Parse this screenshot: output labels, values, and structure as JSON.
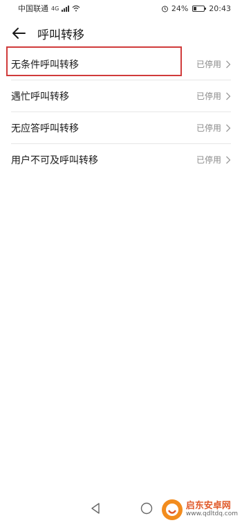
{
  "status_bar": {
    "carrier": "中国联通",
    "network": "4G",
    "battery": "24%",
    "battery_level": 0.24,
    "time": "20:43"
  },
  "header": {
    "title": "呼叫转移",
    "back_icon": "arrow-left-icon"
  },
  "list": {
    "items": [
      {
        "label": "无条件呼叫转移",
        "status": "已停用"
      },
      {
        "label": "遇忙呼叫转移",
        "status": "已停用"
      },
      {
        "label": "无应答呼叫转移",
        "status": "已停用"
      },
      {
        "label": "用户不可及呼叫转移",
        "status": "已停用"
      }
    ]
  },
  "nav_bar": {
    "back_icon": "triangle-back-icon",
    "home_icon": "circle-home-icon"
  },
  "watermark": {
    "title": "启东安卓网",
    "url": "www.qdltdq.com"
  },
  "colors": {
    "highlight": "#d03a3a",
    "divider": "#e6e6e6",
    "status_text": "#8a8a8a"
  }
}
